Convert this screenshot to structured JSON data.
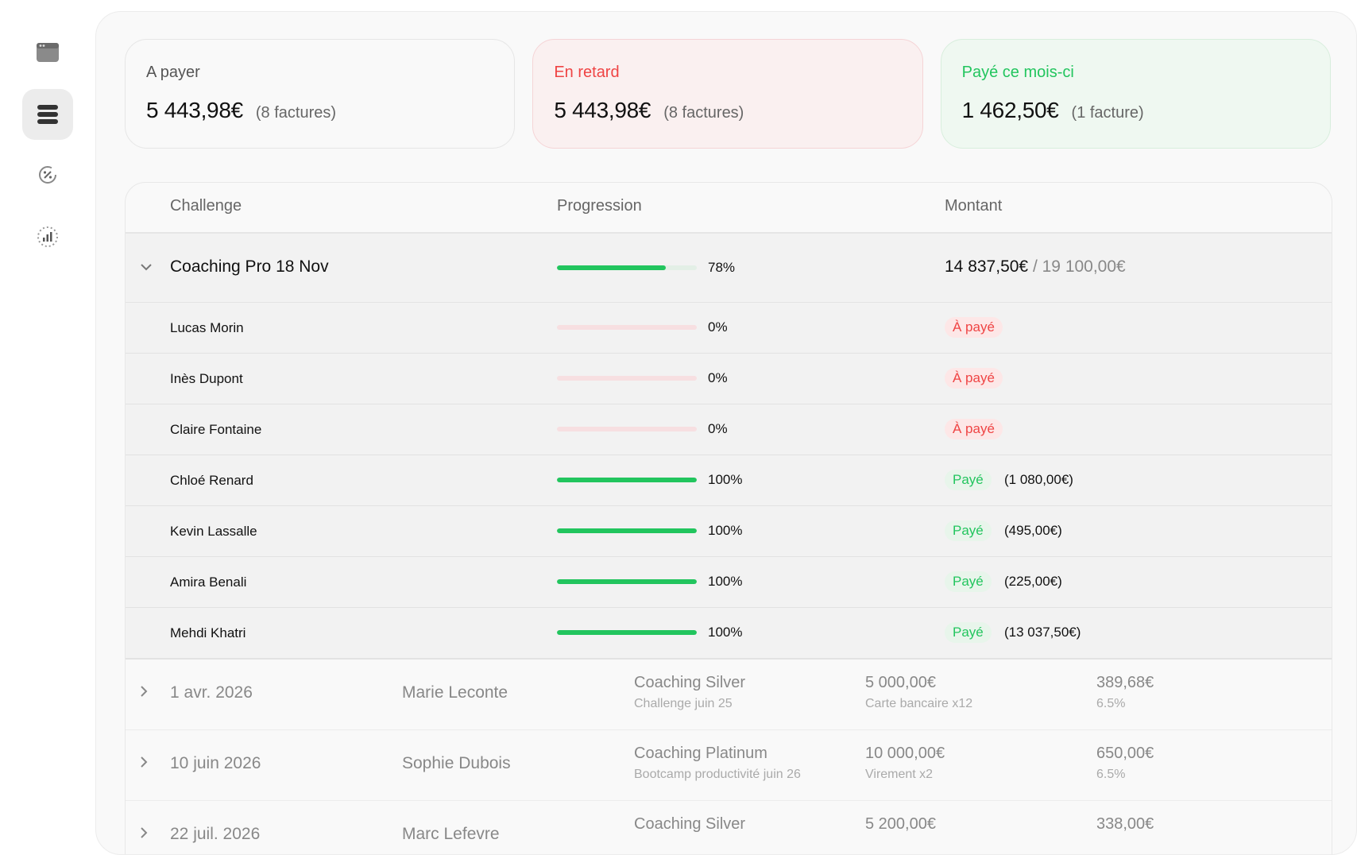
{
  "sidebar": {
    "items": [
      {
        "icon": "window-icon",
        "active": false
      },
      {
        "icon": "list-icon",
        "active": true
      },
      {
        "icon": "percent-icon",
        "active": false
      },
      {
        "icon": "chart-icon",
        "active": false
      }
    ]
  },
  "summary": {
    "to_pay": {
      "label": "A payer",
      "amount": "5 443,98€",
      "count": "(8 factures)"
    },
    "late": {
      "label": "En retard",
      "amount": "5 443,98€",
      "count": "(8 factures)"
    },
    "paid": {
      "label": "Payé ce mois-ci",
      "amount": "1 462,50€",
      "count": "(1 facture)"
    }
  },
  "table": {
    "headers": {
      "challenge": "Challenge",
      "progression": "Progression",
      "amount": "Montant"
    },
    "group": {
      "title": "Coaching Pro 18 Nov",
      "progress": 0.78,
      "percent": "78%",
      "amount": "14 837,50€",
      "total": "/ 19 100,00€"
    },
    "participants": [
      {
        "name": "Lucas Morin",
        "progress": 0,
        "percent": "0%",
        "status": "À payé",
        "paid": false,
        "amount": ""
      },
      {
        "name": "Inès Dupont",
        "progress": 0,
        "percent": "0%",
        "status": "À payé",
        "paid": false,
        "amount": ""
      },
      {
        "name": "Claire Fontaine",
        "progress": 0,
        "percent": "0%",
        "status": "À payé",
        "paid": false,
        "amount": ""
      },
      {
        "name": "Chloé Renard",
        "progress": 1,
        "percent": "100%",
        "status": "Payé",
        "paid": true,
        "amount": "(1 080,00€)"
      },
      {
        "name": "Kevin Lassalle",
        "progress": 1,
        "percent": "100%",
        "status": "Payé",
        "paid": true,
        "amount": "(495,00€)"
      },
      {
        "name": "Amira Benali",
        "progress": 1,
        "percent": "100%",
        "status": "Payé",
        "paid": true,
        "amount": "(225,00€)"
      },
      {
        "name": "Mehdi Khatri",
        "progress": 1,
        "percent": "100%",
        "status": "Payé",
        "paid": true,
        "amount": "(13 037,50€)"
      }
    ],
    "rows": [
      {
        "date": "1 avr. 2026",
        "client": "Marie Leconte",
        "offer": "Coaching Silver",
        "offer_sub": "Challenge juin 25",
        "price": "5 000,00€",
        "payment": "Carte bancaire x12",
        "fee": "389,68€",
        "rate": "6.5%"
      },
      {
        "date": "10 juin 2026",
        "client": "Sophie Dubois",
        "offer": "Coaching Platinum",
        "offer_sub": "Bootcamp productivité juin 26",
        "price": "10 000,00€",
        "payment": "Virement x2",
        "fee": "650,00€",
        "rate": "6.5%"
      },
      {
        "date": "22 juil. 2026",
        "client": "Marc Lefevre",
        "offer": "Coaching Silver",
        "offer_sub": "",
        "price": "5 200,00€",
        "payment": "",
        "fee": "338,00€",
        "rate": ""
      }
    ]
  }
}
